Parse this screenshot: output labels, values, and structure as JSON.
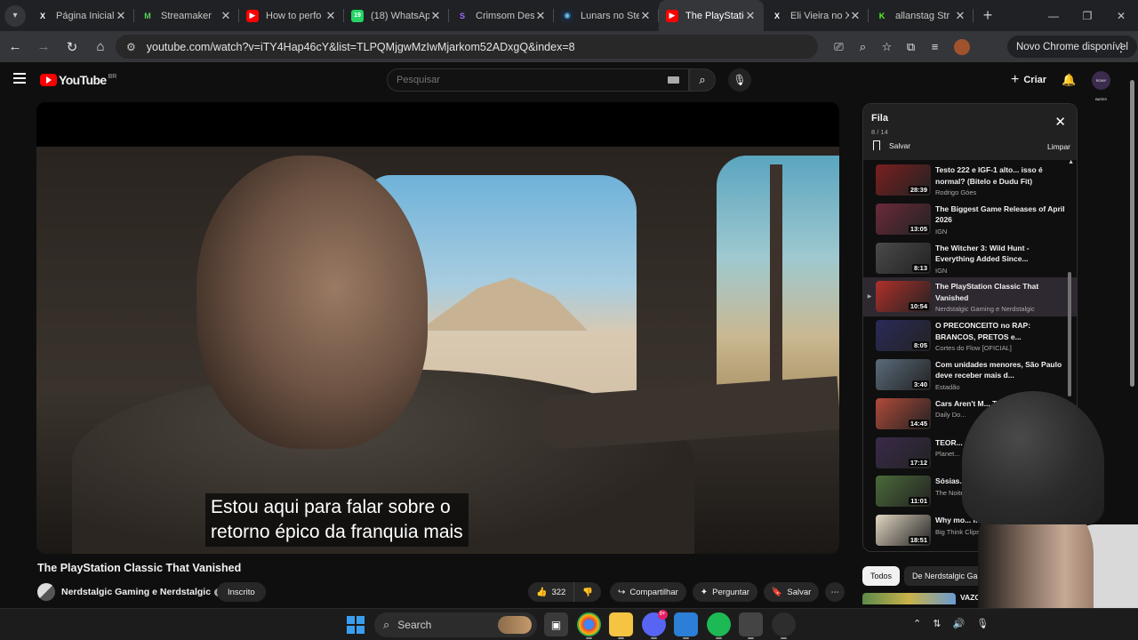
{
  "browser": {
    "tabs": [
      {
        "title": "Página Inicial",
        "favicon": "x-logo-icon",
        "active": false
      },
      {
        "title": "Streamaker",
        "favicon": "streamaker-logo-icon",
        "active": false
      },
      {
        "title": "How to perfo",
        "favicon": "youtube-logo-icon",
        "active": false
      },
      {
        "title": "(18) WhatsAp",
        "favicon": "whatsapp-logo-icon",
        "active": false,
        "badge": "19"
      },
      {
        "title": "Crimsom Des",
        "favicon": "s-logo-icon",
        "active": false
      },
      {
        "title": "Lunars no Ste",
        "favicon": "steam-logo-icon",
        "active": false
      },
      {
        "title": "The PlayStatio",
        "favicon": "youtube-logo-icon",
        "active": true
      },
      {
        "title": "Eli Vieira no X",
        "favicon": "x-logo-icon",
        "active": false
      },
      {
        "title": "allanstag Str",
        "favicon": "kick-logo-icon",
        "active": false
      }
    ],
    "url": "youtube.com/watch?v=iTY4Hap46cY&list=TLPQMjgwMzIwMjarkom52ADxgQ&index=8",
    "update_label": "Novo Chrome disponível"
  },
  "masthead": {
    "logo_text": "YouTube",
    "region": "BR",
    "search_placeholder": "Pesquisar",
    "create_label": "Criar",
    "channel_avatar_text": "RONY BATES"
  },
  "video": {
    "caption_line1": "Estou aqui para falar sobre o",
    "caption_line2": "retorno épico da franquia mais",
    "title": "The PlayStation Classic That Vanished",
    "channel": "Nerdstalgic Gaming e Nerdstalgic",
    "subscribed_label": "Inscrito",
    "likes": "322",
    "share_label": "Compartilhar",
    "ask_label": "Perguntar",
    "save_label": "Salvar"
  },
  "queue": {
    "title": "Fila",
    "position": "8 / 14",
    "save_label": "Salvar",
    "clear_label": "Limpar",
    "items": [
      {
        "title": "Testo 222 e IGF-1 alto... isso é normal? (Bitelo e Dudu Fit)",
        "channel": "Rodrigo Góes",
        "duration": "28:39",
        "color": "#7a1f1f",
        "selected": false
      },
      {
        "title": "The Biggest Game Releases of April 2026",
        "channel": "IGN",
        "duration": "13:05",
        "color": "#6b2a3a",
        "selected": false
      },
      {
        "title": "The Witcher 3: Wild Hunt - Everything Added Since...",
        "channel": "IGN",
        "duration": "8:13",
        "color": "#4a4a4a",
        "selected": false
      },
      {
        "title": "The PlayStation Classic That Vanished",
        "channel": "Nerdstalgic Gaming e Nerdstalgic",
        "duration": "10:54",
        "color": "#b0302a",
        "selected": true
      },
      {
        "title": "O PRECONCEITO no RAP: BRANCOS, PRETOS e...",
        "channel": "Cortes do Flow [OFICIAL]",
        "duration": "8:05",
        "color": "#2a2a5a",
        "selected": false
      },
      {
        "title": "Com unidades menores, São Paulo deve receber mais d...",
        "channel": "Estadão",
        "duration": "3:40",
        "color": "#5a6a7a",
        "selected": false
      },
      {
        "title": "Cars Aren't M... That",
        "channel": "Daily Do...",
        "duration": "14:45",
        "color": "#b04a3a",
        "selected": false
      },
      {
        "title": "TEOR... COM...",
        "channel": "Planet...",
        "duration": "17:12",
        "color": "#3a2a4a",
        "selected": false
      },
      {
        "title": "Sósias... Episódio...",
        "channel": "The Noite...",
        "duration": "11:01",
        "color": "#4a6a3a",
        "selected": false
      },
      {
        "title": "Why mo... misunder...",
        "channel": "Big Think Clips",
        "duration": "18:51",
        "color": "#e0d6c0",
        "selected": false
      }
    ]
  },
  "chips": [
    "Todos",
    "De Nerdstalgic Gaming"
  ],
  "recommendation": {
    "title": "VAZOU!! Re..."
  },
  "taskbar": {
    "search_label": "Search",
    "discord_badge": "9+"
  }
}
